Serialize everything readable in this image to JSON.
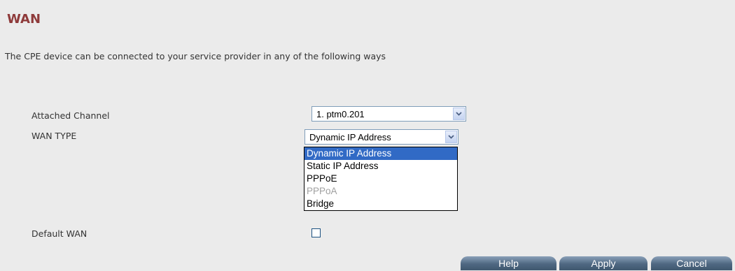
{
  "page": {
    "title": "WAN",
    "intro": "The CPE device can be connected to your service provider in any of the following ways"
  },
  "form": {
    "attached_channel": {
      "label": "Attached Channel",
      "value": "1. ptm0.201"
    },
    "wan_type": {
      "label": "WAN TYPE",
      "value": "Dynamic IP Address",
      "options": [
        {
          "label": "Dynamic IP Address",
          "selected": true,
          "disabled": false
        },
        {
          "label": "Static IP Address",
          "selected": false,
          "disabled": false
        },
        {
          "label": "PPPoE",
          "selected": false,
          "disabled": false
        },
        {
          "label": "PPPoA",
          "selected": false,
          "disabled": true
        },
        {
          "label": "Bridge",
          "selected": false,
          "disabled": false
        }
      ]
    },
    "default_wan": {
      "label": "Default WAN",
      "checked": false
    }
  },
  "buttons": {
    "help": "Help",
    "apply": "Apply",
    "cancel": "Cancel"
  },
  "colors": {
    "title": "#8e3a3a",
    "selection": "#316ac5",
    "button": "#4f6882",
    "background": "#ebebeb"
  },
  "icons": {
    "select_arrow": "chevron-down-icon"
  }
}
